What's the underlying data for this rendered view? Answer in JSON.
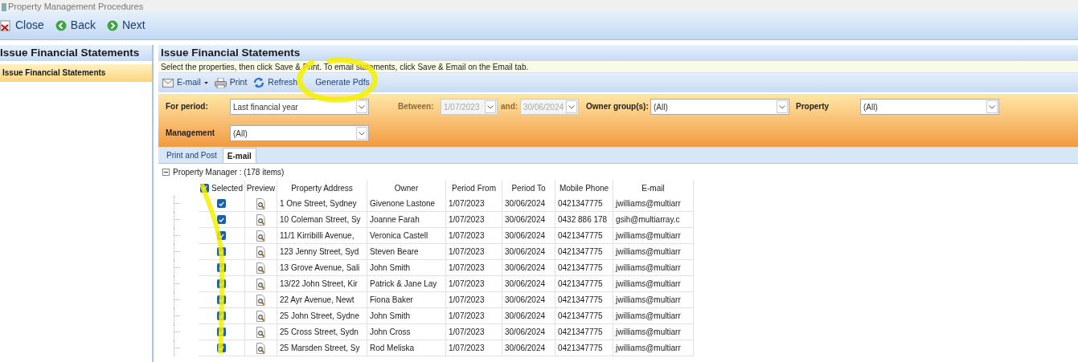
{
  "window": {
    "title": "Property Management Procedures"
  },
  "toolbar": [
    {
      "kind": "close",
      "label": "Close"
    },
    {
      "kind": "back",
      "label": "Back"
    },
    {
      "kind": "next",
      "label": "Next"
    }
  ],
  "sidebar": {
    "title": "Issue Financial Statements",
    "items": [
      {
        "label": "Issue Financial Statements",
        "selected": true
      }
    ]
  },
  "panel": {
    "title": "Issue Financial Statements",
    "info": "Select the properties, then click Save & Print. To email statements, click Save & Email on the Email tab.",
    "actions": [
      {
        "kind": "email",
        "label": "E-mail",
        "dropdown": true
      },
      {
        "kind": "print",
        "label": "Print",
        "dropdown": false
      },
      {
        "kind": "refresh",
        "label": "Refresh",
        "dropdown": false
      },
      {
        "kind": "text",
        "label": "Generate Pdfs",
        "dropdown": false
      }
    ],
    "filters": {
      "period_label": "For period:",
      "period": "Last financial year",
      "between_label": "Between:",
      "from": "1/07/2023",
      "and_label": "and:",
      "to": "30/06/2024",
      "owner_label": "Owner group(s):",
      "owner": "(All)",
      "property_label": "Property",
      "property": "(All)",
      "management_label": "Management",
      "management": "(All)"
    },
    "tabs": [
      {
        "label": "Print and Post",
        "selected": false
      },
      {
        "label": "E-mail",
        "selected": true
      }
    ],
    "group": {
      "label": "Property Manager : (178 items)",
      "expanded": true
    },
    "table": {
      "all_selected": true,
      "columns": [
        "Selected",
        "Preview",
        "Property Address",
        "Owner",
        "Period From",
        "Period To",
        "Mobile Phone",
        "E-mail"
      ],
      "rows": [
        {
          "selected": true,
          "address": "1 One Street, Sydney",
          "owner": "Givenone Lastone",
          "from": "1/07/2023",
          "to": "30/06/2024",
          "phone": "0421347775",
          "email": "jwilliams@multiarr"
        },
        {
          "selected": true,
          "address": "10 Coleman Street, Sy",
          "owner": "Joanne Farah",
          "from": "1/07/2023",
          "to": "30/06/2024",
          "phone": "0432 886 178",
          "email": "gsih@multiarray.c"
        },
        {
          "selected": true,
          "address": "11/1 Kirribilli Avenue,",
          "owner": "Veronica Castell",
          "from": "1/07/2023",
          "to": "30/06/2024",
          "phone": "0421347775",
          "email": "jwilliams@multiarr"
        },
        {
          "selected": true,
          "address": "123 Jenny Street, Syd",
          "owner": "Steven Beare",
          "from": "1/07/2023",
          "to": "30/06/2024",
          "phone": "0421347775",
          "email": "jwilliams@multiarr"
        },
        {
          "selected": true,
          "address": "13 Grove Avenue, Sali",
          "owner": "John Smith",
          "from": "1/07/2023",
          "to": "30/06/2024",
          "phone": "0421347775",
          "email": "jwilliams@multiarr"
        },
        {
          "selected": true,
          "address": "13/22 John Street, Kir",
          "owner": "Patrick & Jane Lay",
          "from": "1/07/2023",
          "to": "30/06/2024",
          "phone": "0421347775",
          "email": "jwilliams@multiarr"
        },
        {
          "selected": true,
          "address": "22 Ayr Avenue, Newt",
          "owner": "Fiona Baker",
          "from": "1/07/2023",
          "to": "30/06/2024",
          "phone": "0421347775",
          "email": "jwilliams@multiarr"
        },
        {
          "selected": true,
          "address": "25 John Street, Sydne",
          "owner": "John Smith",
          "from": "1/07/2023",
          "to": "30/06/2024",
          "phone": "0421347775",
          "email": "jwilliams@multiarr"
        },
        {
          "selected": true,
          "address": "25 Cross Street, Sydn",
          "owner": "John Cross",
          "from": "1/07/2023",
          "to": "30/06/2024",
          "phone": "0421347775",
          "email": "jwilliams@multiarr"
        },
        {
          "selected": true,
          "address": "25 Marsden Street, Sy",
          "owner": "Rod Meliska",
          "from": "1/07/2023",
          "to": "30/06/2024",
          "phone": "0421347775",
          "email": "jwilliams@multiarr"
        }
      ]
    }
  }
}
